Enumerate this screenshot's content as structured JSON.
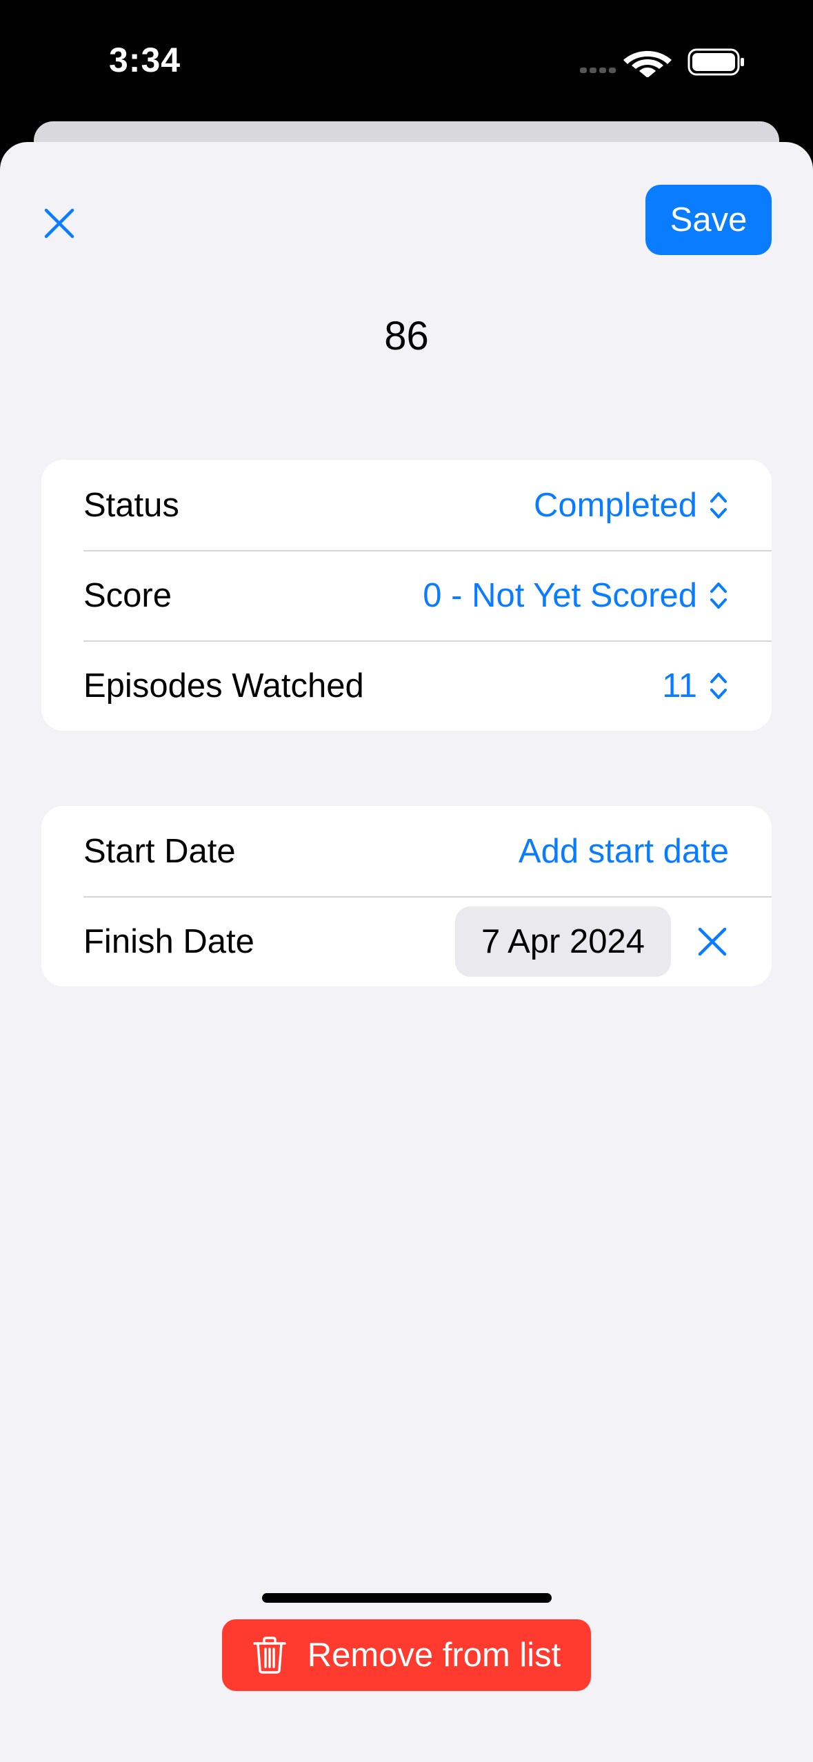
{
  "status_bar": {
    "time": "3:34"
  },
  "header": {
    "save_label": "Save",
    "title": "86"
  },
  "tracking_card": {
    "rows": [
      {
        "label": "Status",
        "value": "Completed"
      },
      {
        "label": "Score",
        "value": "0 - Not Yet Scored"
      },
      {
        "label": "Episodes Watched",
        "value": "11"
      }
    ]
  },
  "dates_card": {
    "start": {
      "label": "Start Date",
      "value": "Add start date"
    },
    "finish": {
      "label": "Finish Date",
      "value": "7 Apr 2024"
    }
  },
  "remove_button": {
    "label": "Remove from list"
  },
  "colors": {
    "accent": "#0a7cff",
    "destructive": "#ff3b30",
    "background": "#f2f2f7"
  },
  "icons": [
    "signal-icon",
    "wifi-icon",
    "battery-icon",
    "close-icon",
    "chevron-up-down-icon",
    "trash-icon"
  ]
}
